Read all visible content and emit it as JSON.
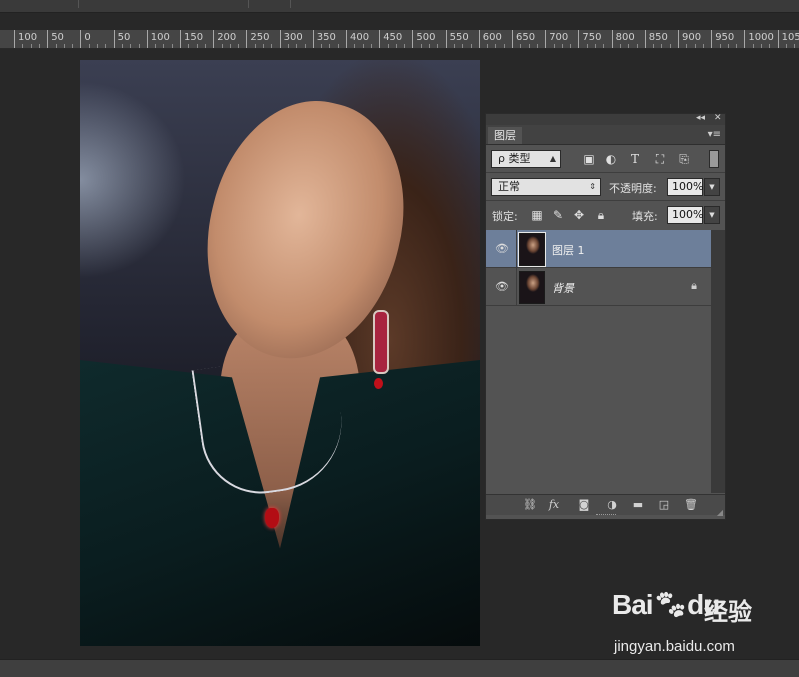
{
  "ruler": {
    "ticks": [
      "100",
      "50",
      "0",
      "50",
      "100",
      "150",
      "200",
      "250",
      "300",
      "350",
      "400",
      "450",
      "500",
      "550",
      "600",
      "650",
      "700",
      "750",
      "800",
      "850",
      "900",
      "950",
      "1000",
      "105"
    ]
  },
  "layers_panel": {
    "tab_label": "图层",
    "collapse_glyph": "◂◂",
    "close_glyph": "✕",
    "menu_glyph": "▾≡",
    "filter": {
      "label": "ρ 类型"
    },
    "blend": {
      "mode": "正常",
      "opacity_label": "不透明度:",
      "opacity_value": "100%"
    },
    "lock": {
      "label": "锁定:",
      "fill_label": "填充:",
      "fill_value": "100%"
    },
    "layers": [
      {
        "name": "图层 1",
        "selected": true,
        "visible": true,
        "locked": false
      },
      {
        "name": "背景",
        "selected": false,
        "visible": true,
        "locked": true
      }
    ],
    "bottom_icons": [
      "link-icon",
      "fx-icon",
      "mask-icon",
      "adjustment-icon",
      "folder-icon",
      "new-layer-icon",
      "trash-icon"
    ],
    "fx_label": "fx"
  },
  "watermark": {
    "brand": "Bai",
    "brand_tail": "du",
    "product": "经验",
    "url": "jingyan.baidu.com"
  }
}
